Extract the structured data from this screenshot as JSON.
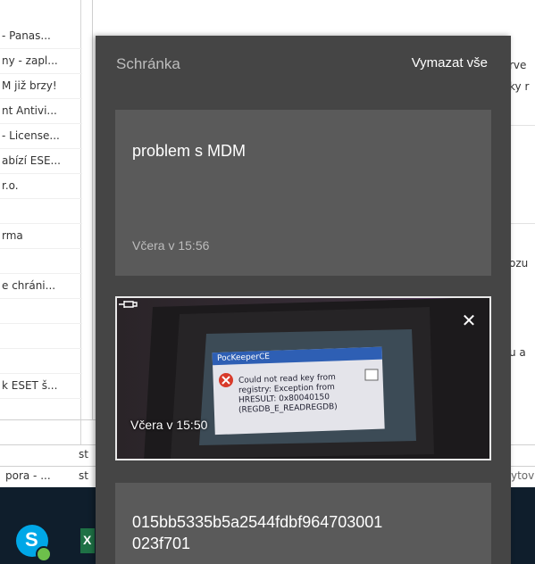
{
  "background": {
    "email_rows": [
      "- Panas...",
      "ny - zapl...",
      "M již brzy!",
      "nt Antivi...",
      "- License...",
      "abízí ESE...",
      "r.o.",
      "",
      "rma",
      "",
      "e chráni...",
      "",
      "",
      "",
      "k ESET š...",
      ""
    ],
    "bottom_rows": [
      {
        "left": "",
        "mid": "st"
      },
      {
        "left": "pora - ...",
        "mid": "st"
      }
    ],
    "right_snippets": [
      "rve",
      "ky r",
      "ozu",
      "u a",
      "ytov"
    ]
  },
  "clipboard": {
    "title": "Schránka",
    "clear_all_label": "Vymazat vše",
    "items": [
      {
        "text": "problem s MDM",
        "time": "Včera v 15:56"
      },
      {
        "type": "image",
        "time": "Včera v 15:50"
      },
      {
        "text": "015bb5335b5a2544fdbf964703001023f701",
        "text_line1": "015bb5335b5a2544fdbf964703001",
        "text_line2": "023f701"
      }
    ],
    "image_dialog": {
      "title": "PocKeeperCE",
      "lines": [
        "Could not read key from",
        "registry: Exception from",
        "HRESULT: 0x80040150",
        "(REGDB_E_READREGDB)"
      ]
    }
  },
  "taskbar": {
    "apps": [
      "skype-icon",
      "excel-icon"
    ]
  },
  "colors": {
    "panel_bg": "#454545",
    "card_bg": "#5a5a5a",
    "taskbar_bg": "#0f1e2c",
    "accent_white": "#ffffff"
  }
}
